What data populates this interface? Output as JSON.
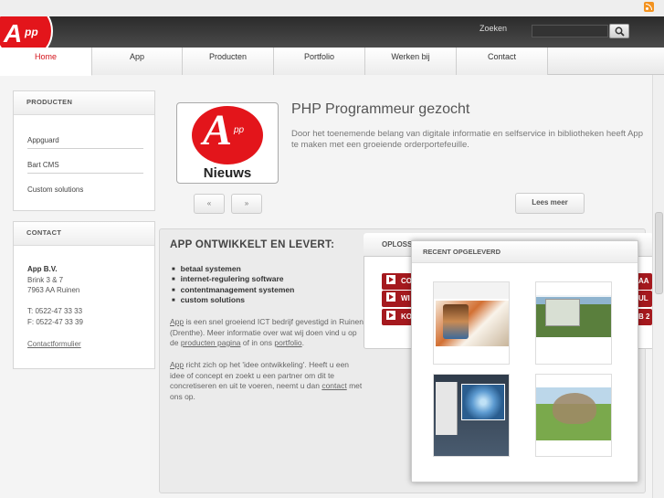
{
  "header": {
    "search_label": "Zoeken",
    "search_value": "",
    "logo_text": "pp"
  },
  "nav": {
    "tabs": [
      {
        "label": "Home",
        "active": true
      },
      {
        "label": "App",
        "active": false
      },
      {
        "label": "Producten",
        "active": false
      },
      {
        "label": "Portfolio",
        "active": false
      },
      {
        "label": "Werken bij",
        "active": false
      },
      {
        "label": "Contact",
        "active": false
      }
    ]
  },
  "sidebar": {
    "producten": {
      "title": "PRODUCTEN",
      "items": [
        "Appguard",
        "Bart CMS",
        "Custom solutions"
      ]
    },
    "contact": {
      "title": "CONTACT",
      "company": "App B.V.",
      "street": "Brink 3 & 7",
      "city": "7963 AA Ruinen",
      "phone": "T: 0522-47 33 33",
      "fax": "F: 0522-47 33 39",
      "form_link": "Contactformulier"
    }
  },
  "news": {
    "image_caption": "Nieuws",
    "image_small": "pp",
    "title": "PHP Programmeur gezocht",
    "text": "Door het toenemende belang van digitale informatie en selfservice in bibliotheken heeft App te maken met een groeiende orderportefeuille.",
    "prev_label": "«",
    "next_label": "»",
    "more_label": "Lees meer"
  },
  "main": {
    "title": "APP ONTWIKKELT EN LEVERT:",
    "bullets": [
      "betaal systemen",
      "internet-regulering software",
      "contentmanagement systemen",
      "custom solutions"
    ],
    "p1": {
      "link1": "App",
      "text1": " is een snel groeiend ICT bedrijf gevestigd in Ruinen (Drenthe). Meer informatie over wat wij doen vind u op de ",
      "link2": "producten pagina",
      "text2": " of in ons ",
      "link3": "portfolio",
      "text3": "."
    },
    "p2": {
      "link1": "App",
      "text1": " richt zich op het 'idee ontwikkeling'. Heeft u een idee of concept en zoekt u een partner om dit te concretiseren en uit te voeren, neemt u dan ",
      "link2": "contact",
      "text2": " met ons op."
    }
  },
  "oplossingen": {
    "title": "OPLOSS",
    "buttons": [
      "CO",
      "WI",
      "KO"
    ],
    "right_fragments": [
      "AA",
      "UL",
      "B 2"
    ]
  },
  "recent": {
    "title": "RECENT OPGELEVERD"
  }
}
